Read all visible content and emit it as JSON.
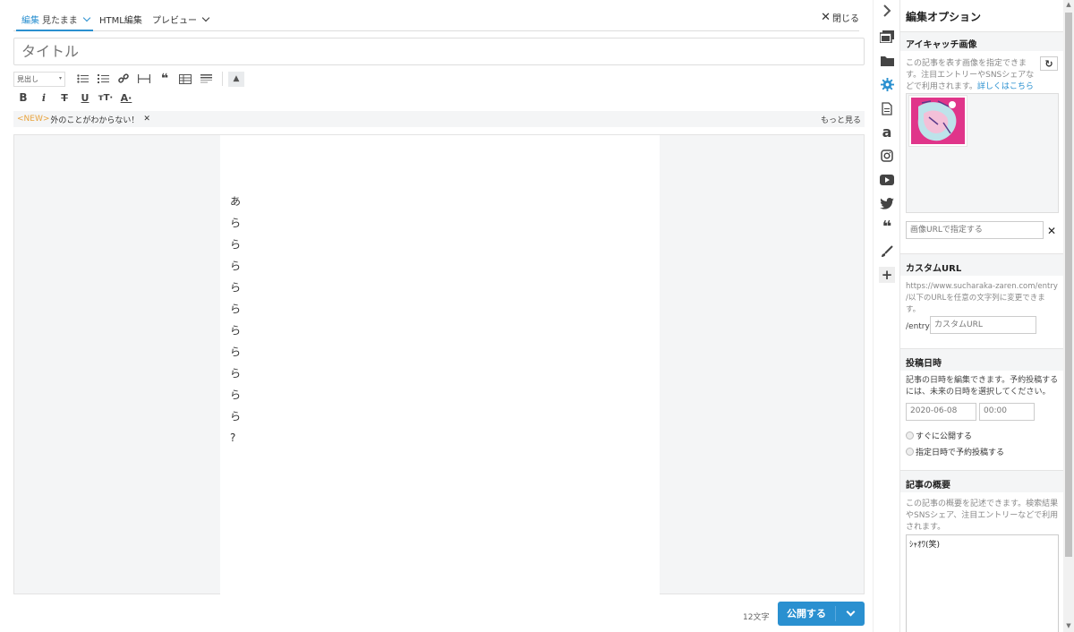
{
  "editor": {
    "tabs": {
      "edit_label": "編集",
      "edit_mode": "見たまま",
      "html_label": "HTML編集",
      "preview_label": "プレビュー"
    },
    "close_label": "閉じる",
    "title_placeholder": "タイトル",
    "toolbar": {
      "heading_select": "見出し"
    },
    "notice": {
      "badge": "<NEW>",
      "text": "外のことがわからない！",
      "more": "もっと見る"
    },
    "body_lines": [
      "あ",
      "ら",
      "ら",
      "ら",
      "ら",
      "ら",
      "ら",
      "ら",
      "ら",
      "ら",
      "ら",
      "?"
    ],
    "char_count": "12文字",
    "publish_label": "公開する"
  },
  "panel": {
    "title": "編集オプション",
    "eyecatch": {
      "title": "アイキャッチ画像",
      "desc_line1": "この記事を表す画像を指定できま",
      "desc_line2": "す。注目エントリーやSNSシェアな",
      "desc_line3": "どで利用されます。",
      "link": "詳しくはこちら",
      "url_placeholder": "画像URLで指定する"
    },
    "custom_url": {
      "title": "カスタムURL",
      "desc_line1": "https://www.sucharaka-zaren.com/entry",
      "desc_line2": "/以下のURLを任意の文字列に変更できま",
      "desc_line3": "す。",
      "prefix": "/entry/",
      "placeholder": "カスタムURL"
    },
    "post_date": {
      "title": "投稿日時",
      "desc_line1": "記事の日時を編集できます。予約投稿する",
      "desc_line2": "には、未来の日時を選択してください。",
      "date": "2020-06-08",
      "time": "00:00",
      "option_now": "すぐに公開する",
      "option_schedule": "指定日時で予約投稿する"
    },
    "summary": {
      "title": "記事の概要",
      "desc_line1": "この記事の概要を記述できます。検索結果",
      "desc_line2": "やSNSシェア、注目エントリーなどで利用",
      "desc_line3": "されます。",
      "value": "ｼｬｵﾜ(笑)"
    }
  },
  "colors": {
    "accent": "#2a90d0",
    "new_badge": "#e8a33d"
  }
}
